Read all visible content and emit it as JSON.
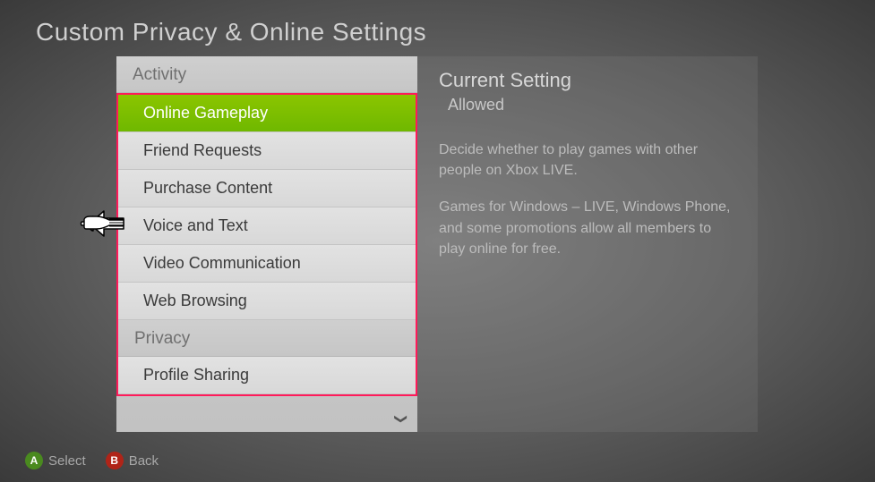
{
  "title": "Custom Privacy & Online Settings",
  "sections": {
    "activity": {
      "header": "Activity",
      "items": [
        "Online Gameplay",
        "Friend Requests",
        "Purchase Content",
        "Voice and Text",
        "Video Communication",
        "Web Browsing"
      ],
      "selected": 0
    },
    "privacy": {
      "header": "Privacy",
      "items": [
        "Profile Sharing"
      ]
    }
  },
  "current_setting": {
    "title": "Current Setting",
    "value": "Allowed",
    "desc1": "Decide whether to play games with other people on Xbox LIVE.",
    "desc2": "Games for Windows – LIVE, Windows Phone, and some promotions allow all members to play online for free."
  },
  "footer": {
    "a_label": "Select",
    "b_label": "Back"
  }
}
